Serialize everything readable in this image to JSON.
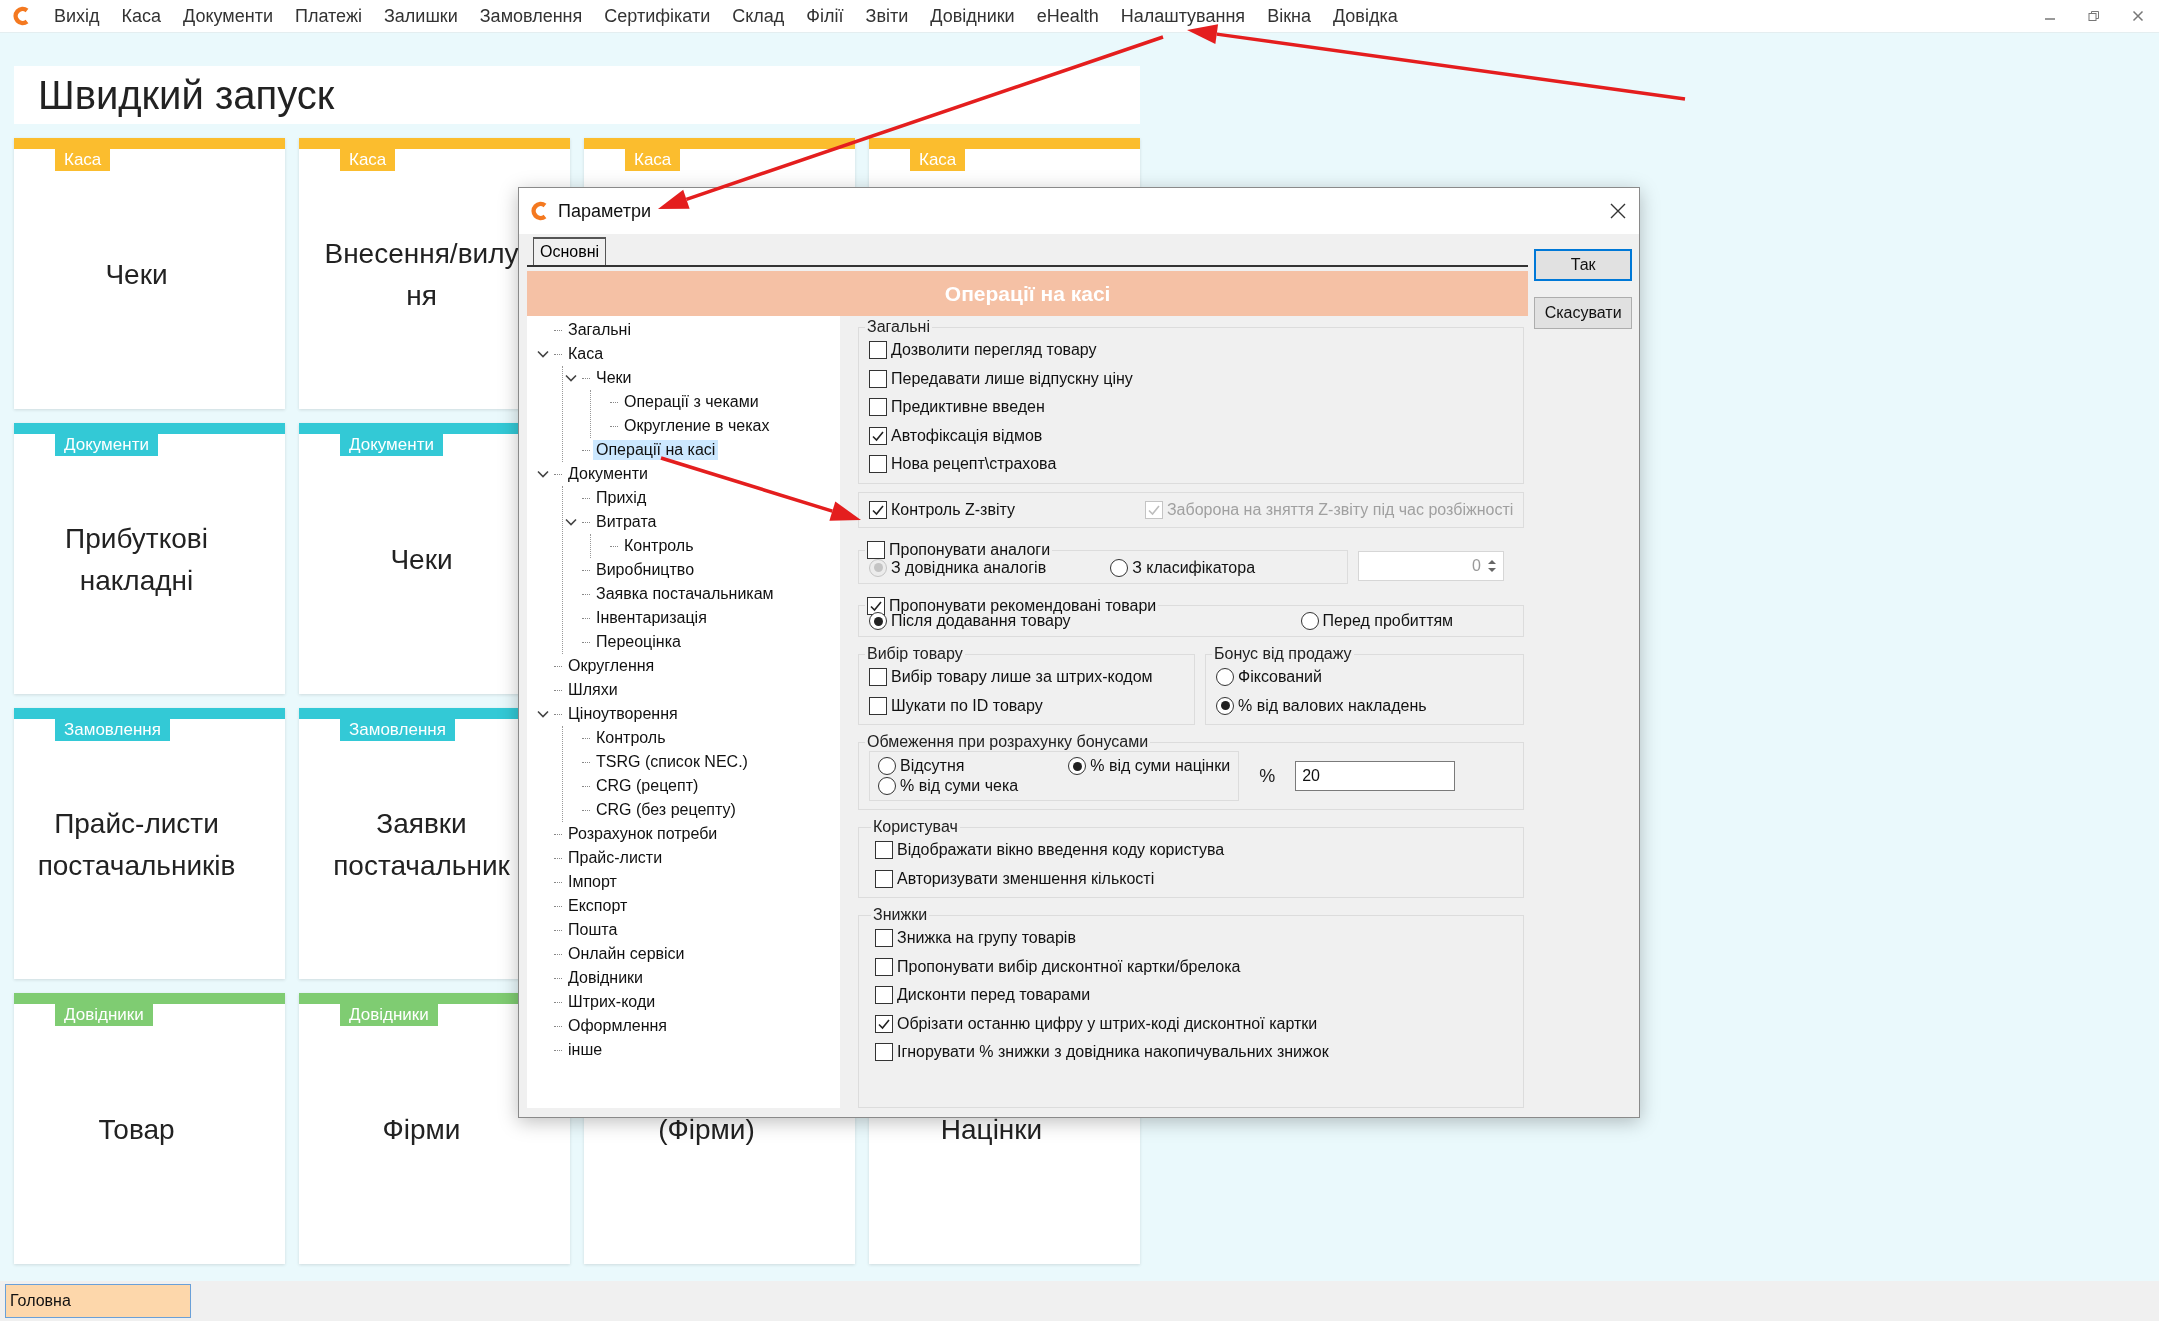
{
  "menu": {
    "items": [
      "Вихід",
      "Каса",
      "Документи",
      "Платежі",
      "Залишки",
      "Замовлення",
      "Сертифікати",
      "Склад",
      "Філії",
      "Звіти",
      "Довідники",
      "eHealth",
      "Налаштування",
      "Вікна",
      "Довідка"
    ]
  },
  "quick_launch": {
    "title": "Швидкий запуск",
    "rows": [
      [
        {
          "category": "Каса",
          "color": "#fbbd2e",
          "title_lines": [
            "Чеки"
          ]
        },
        {
          "category": "Каса",
          "color": "#fbbd2e",
          "title_lines": [
            "Внесення/вилу",
            "ня"
          ]
        },
        {
          "category": "Каса",
          "color": "#fbbd2e"
        },
        {
          "category": "Каса",
          "color": "#fbbd2e"
        }
      ],
      [
        {
          "category": "Документи",
          "color": "#33c9d6",
          "title_lines": [
            "Прибуткові",
            "накладні"
          ]
        },
        {
          "category": "Документи",
          "color": "#33c9d6",
          "title_lines": [
            "Чеки"
          ]
        }
      ],
      [
        {
          "category": "Замовлення",
          "color": "#33c9d6",
          "title_lines": [
            "Прайс-листи",
            "постачальників"
          ]
        },
        {
          "category": "Замовлення",
          "color": "#33c9d6",
          "title_lines": [
            "Заявки",
            "постачальник"
          ]
        }
      ],
      [
        {
          "category": "Довідники",
          "color": "#7fcc72",
          "title_lines": [
            "Товар"
          ]
        },
        {
          "category": "Довідники",
          "color": "#7fcc72",
          "title_lines": [
            "Фірми"
          ]
        },
        {
          "title_lines": [
            "(Фірми)"
          ]
        },
        {
          "title_lines": [
            "Націнки"
          ]
        }
      ]
    ]
  },
  "dialog": {
    "title": "Параметри",
    "tabs": [
      {
        "label": "Основні",
        "selected": true
      }
    ],
    "section_title": "Операції на касі",
    "buttons": [
      {
        "label": "Так",
        "kind": "default"
      },
      {
        "label": "Скасувати",
        "kind": "normal"
      }
    ],
    "tree": [
      {
        "label": "Загальні",
        "selected": false
      },
      {
        "label": "Каса",
        "selected": false,
        "expanded": true,
        "children": [
          {
            "label": "Чеки",
            "selected": false,
            "expanded": true,
            "children": [
              {
                "label": "Операції з чеками",
                "selected": false
              },
              {
                "label": "Округление в чеках",
                "selected": false
              }
            ]
          },
          {
            "label": "Операції на касі",
            "selected": true
          }
        ]
      },
      {
        "label": "Документи",
        "selected": false,
        "expanded": true,
        "children": [
          {
            "label": "Прихід",
            "selected": false
          },
          {
            "label": "Витрата",
            "selected": false,
            "expanded": true,
            "children": [
              {
                "label": "Контроль",
                "selected": false
              }
            ]
          },
          {
            "label": "Виробництво",
            "selected": false
          },
          {
            "label": "Заявка постачальникам",
            "selected": false
          },
          {
            "label": "Інвентаризація",
            "selected": false
          },
          {
            "label": "Переоцінка",
            "selected": false
          }
        ]
      },
      {
        "label": "Округлення",
        "selected": false
      },
      {
        "label": "Шляхи",
        "selected": false
      },
      {
        "label": "Ціноутворення",
        "selected": false,
        "expanded": true,
        "children": [
          {
            "label": "Контроль",
            "selected": false
          },
          {
            "label": "TSRG (список NEC.)",
            "selected": false
          },
          {
            "label": "CRG (рецепт)",
            "selected": false
          },
          {
            "label": "CRG (без рецепту)",
            "selected": false
          }
        ]
      },
      {
        "label": "Розрахунок потреби",
        "selected": false
      },
      {
        "label": "Прайс-листи",
        "selected": false
      },
      {
        "label": "Імпорт",
        "selected": false
      },
      {
        "label": "Експорт",
        "selected": false
      },
      {
        "label": "Пошта",
        "selected": false
      },
      {
        "label": "Онлайн сервіси",
        "selected": false
      },
      {
        "label": "Довідники",
        "selected": false
      },
      {
        "label": "Штрих-коди",
        "selected": false
      },
      {
        "label": "Оформлення",
        "selected": false
      },
      {
        "label": "інше",
        "selected": false
      }
    ],
    "settings": {
      "general": {
        "legend": "Загальні",
        "options": [
          {
            "label": "Дозволити перегляд товару",
            "checked": false
          },
          {
            "label": "Передавати лише відпускну ціну",
            "checked": false
          },
          {
            "label": "Предиктивне введен",
            "checked": false
          },
          {
            "label": "Автофіксація відмов",
            "checked": true
          },
          {
            "label": "Нова рецепт\\страхова",
            "checked": false
          }
        ]
      },
      "z_report": {
        "control": {
          "label": "Контроль Z-звіту",
          "checked": true
        },
        "prohibit": {
          "label": "Заборона на зняття Z-звіту під час розбіжності",
          "checked": true,
          "disabled": true
        }
      },
      "analogs": {
        "legend_checkbox": {
          "label": "Пропонувати аналоги",
          "checked": false
        },
        "options": [
          {
            "label": "З довідника аналогів",
            "selected": true,
            "disabled": true
          },
          {
            "label": "З класифікатора",
            "selected": false,
            "disabled": false
          }
        ],
        "count_field": {
          "value": "0",
          "disabled": true
        }
      },
      "recommended": {
        "legend_checkbox": {
          "label": "Пропонувати рекомендовані товари",
          "checked": true
        },
        "options": [
          {
            "label": "Після додавання товару",
            "selected": true
          },
          {
            "label": "Перед пробиттям",
            "selected": false
          }
        ]
      },
      "product_choice": {
        "legend": "Вибір товару",
        "options": [
          {
            "label": "Вибір товару лише за штрих-кодом",
            "checked": false
          },
          {
            "label": "Шукати по ID товару",
            "checked": false
          }
        ]
      },
      "sale_bonus": {
        "legend": "Бонус від продажу",
        "options": [
          {
            "label": "Фіксований",
            "selected": false
          },
          {
            "label": "% від валових накладень",
            "selected": true
          }
        ]
      },
      "bonus_limit": {
        "legend": "Обмеження при розрахунку бонусами",
        "options": [
          {
            "label": "Відсутня",
            "selected": false
          },
          {
            "label": "% від суми чека",
            "selected": false
          },
          {
            "label": "% від суми націнки",
            "selected": true
          }
        ],
        "percent_label": "%",
        "percent_field": {
          "value": "20"
        }
      },
      "user": {
        "legend": "Користувач",
        "options": [
          {
            "label": "Відображати вікно введення коду користува",
            "checked": false
          },
          {
            "label": "Авторизувати зменшення кількості",
            "checked": false
          }
        ]
      },
      "discounts": {
        "legend": "Знижки",
        "options": [
          {
            "label": "Знижка на групу товарів",
            "checked": false
          },
          {
            "label": "Пропонувати вибір дисконтної картки/брелока",
            "checked": false
          },
          {
            "label": "Дисконти перед товарами",
            "checked": false
          },
          {
            "label": "Обрізати останню цифру у штрих-коді дисконтної картки",
            "checked": true
          },
          {
            "label": "Ігнорувати % знижки з довідника накопичувальних знижок",
            "checked": false
          }
        ]
      }
    }
  },
  "status_bar": {
    "tabs": [
      {
        "label": "Головна",
        "selected": true
      }
    ]
  }
}
